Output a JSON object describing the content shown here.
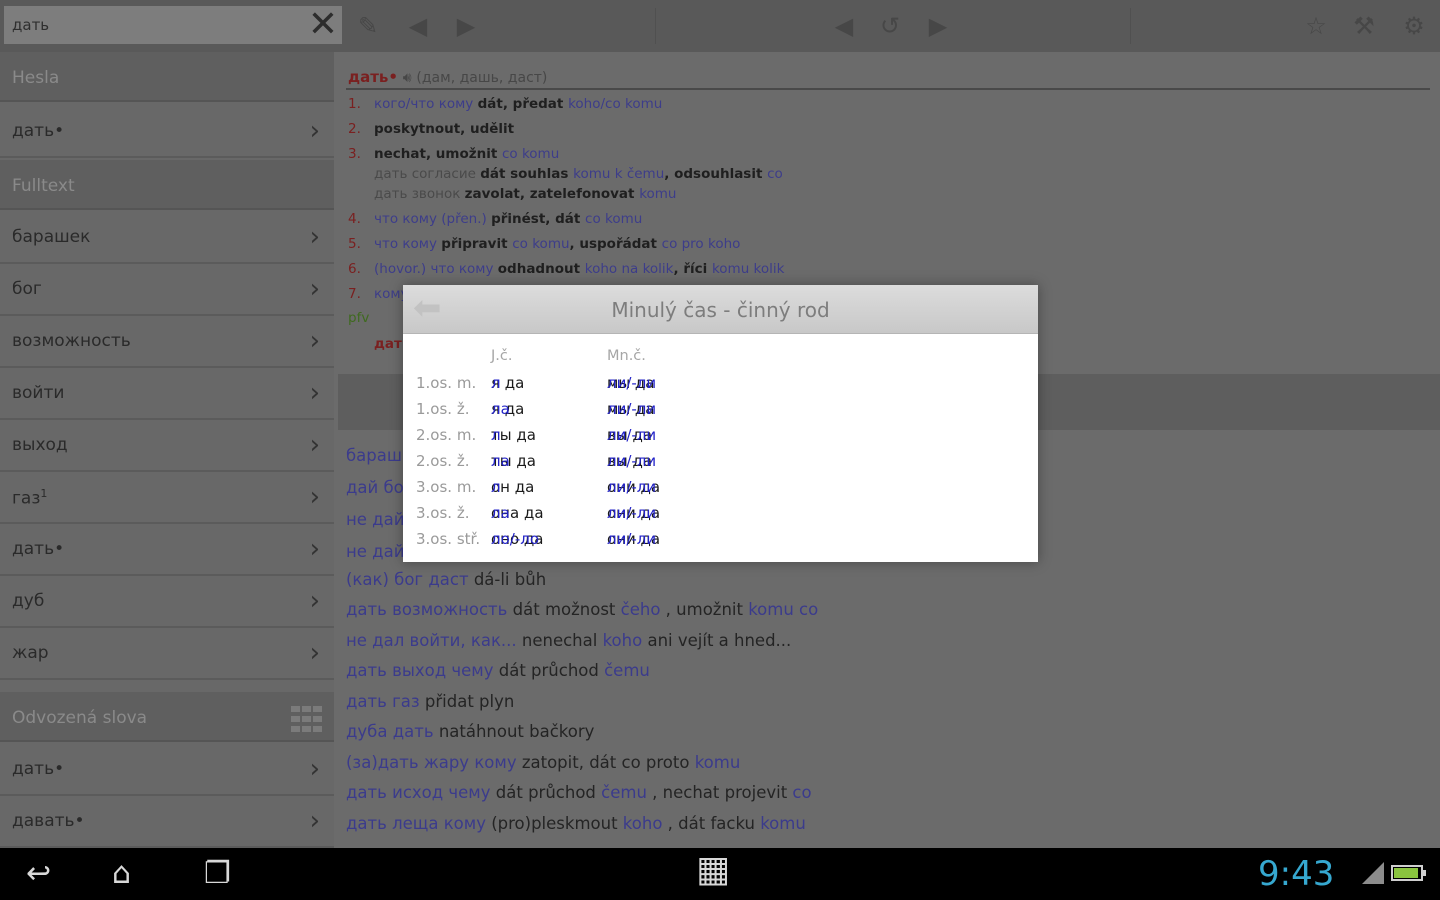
{
  "search": {
    "value": "дать"
  },
  "sidebar": {
    "sections": {
      "hesla": "Hesla",
      "fulltext": "Fulltext",
      "odvozena": "Odvozená slova"
    },
    "hesla_items": [
      {
        "label": "дать•"
      }
    ],
    "fulltext_items": [
      {
        "label": "барашек"
      },
      {
        "label": "бог"
      },
      {
        "label": "возможность"
      },
      {
        "label": "войти"
      },
      {
        "label": "выход"
      },
      {
        "label": "газ",
        "sup": "1"
      },
      {
        "label": "дать•"
      },
      {
        "label": "дуб"
      },
      {
        "label": "жар"
      }
    ],
    "odvozena_items": [
      {
        "label": "дать•"
      },
      {
        "label": "давать•"
      }
    ]
  },
  "entry": {
    "headword": "дать•",
    "forms": "(дам, дашь, даст)",
    "senses": [
      {
        "n": "1.",
        "parts": [
          [
            "ru",
            "кого/что кому "
          ],
          [
            "cz",
            "dát, předat "
          ],
          [
            "ru",
            "koho/co komu"
          ]
        ]
      },
      {
        "n": "2.",
        "parts": [
          [
            "cz",
            "poskytnout, udělit"
          ]
        ]
      },
      {
        "n": "3.",
        "parts": [
          [
            "cz",
            "nechat, umožnit "
          ],
          [
            "ru",
            "co komu"
          ]
        ]
      },
      {
        "n": "",
        "parts": [
          [
            "gr",
            "дать согласие "
          ],
          [
            "cz",
            "dát souhlas "
          ],
          [
            "ru",
            "komu k čemu"
          ],
          [
            "cz",
            ", odsouhlasit "
          ],
          [
            "ru",
            "co"
          ]
        ]
      },
      {
        "n": "",
        "parts": [
          [
            "gr",
            "дать звонок "
          ],
          [
            "cz",
            "zavolat, zatelefonovat "
          ],
          [
            "ru",
            "komu"
          ]
        ]
      },
      {
        "n": "4.",
        "parts": [
          [
            "ru",
            "что кому (přen.) "
          ],
          [
            "cz",
            "přinést, dát "
          ],
          [
            "ru",
            "co komu"
          ]
        ]
      },
      {
        "n": "5.",
        "parts": [
          [
            "ru",
            "что кому "
          ],
          [
            "cz",
            "připravit "
          ],
          [
            "ru",
            "co komu"
          ],
          [
            "cz",
            ", uspořádat "
          ],
          [
            "ru",
            "co pro koho"
          ]
        ]
      },
      {
        "n": "6.",
        "parts": [
          [
            "ru",
            "(hovor.) что кому "
          ],
          [
            "cz",
            "odhadnout "
          ],
          [
            "ru",
            "koho na kolik"
          ],
          [
            "cz",
            ", říci "
          ],
          [
            "ru",
            "komu kolik"
          ]
        ]
      },
      {
        "n": "7.",
        "parts": [
          [
            "ru",
            "кому"
          ]
        ]
      }
    ],
    "pfv_label": "pfv",
    "pfv_word": "дать"
  },
  "phrases": [
    {
      "ru": "бараш",
      "cz": ""
    },
    {
      "ru": "дай бо",
      "cz": ""
    },
    {
      "ru": "не дай",
      "cz": ""
    },
    {
      "ru": "не дай",
      "cz": ""
    },
    {
      "ru": "(как) бог даст",
      "cz": "dá-li bůh"
    },
    {
      "ru": "дать возможность",
      "cz": "dát možnost",
      "ru2": "čeho",
      "cz2": ", umožnit",
      "ru3": "komu co"
    },
    {
      "ru": "не дал войти, как...",
      "cz": "nenechal",
      "ru2": "koho",
      "cz2": "ani vejít a hned..."
    },
    {
      "ru": "дать выход чему",
      "cz": "dát průchod",
      "ru2": "čemu"
    },
    {
      "ru": "дать газ",
      "cz": "přidat plyn"
    },
    {
      "ru": "дуба дать",
      "cz": "natáhnout bačkory"
    },
    {
      "ru": "(за)дать жару кому",
      "cz": "zatopit, dát co proto",
      "ru2": "komu"
    },
    {
      "ru": "дать исход чему",
      "cz": "dát průchod",
      "ru2": "čemu",
      "cz2": ", nechat projevit",
      "ru3": "co"
    },
    {
      "ru": "дать леща кому",
      "cz": "(pro)pleskmout",
      "ru2": "koho",
      "cz2": ", dát facku",
      "ru3": "komu"
    }
  ],
  "dialog": {
    "title": "Minulý čas - činný rod",
    "col_singular": "J.č.",
    "col_plural": "Mn.č.",
    "rows": [
      {
        "label": "1.os. m.",
        "s_stem": "я да",
        "s_suf": "л",
        "p_stem": "мы да",
        "p_suf": "ли/-ли"
      },
      {
        "label": "1.os. ž.",
        "s_stem": "я да",
        "s_suf": "ла",
        "p_stem": "мы да",
        "p_suf": "ли/-ли"
      },
      {
        "label": "2.os. m.",
        "s_stem": "ты да",
        "s_suf": "л",
        "p_stem": "вы да",
        "p_suf": "ли/-ли"
      },
      {
        "label": "2.os. ž.",
        "s_stem": "ты да",
        "s_suf": "ла",
        "p_stem": "вы да",
        "p_suf": "ли/-ли"
      },
      {
        "label": "3.os. m.",
        "s_stem": "он да",
        "s_suf": "л",
        "p_stem": "они да",
        "p_suf": "ли/-ли"
      },
      {
        "label": "3.os. ž.",
        "s_stem": "она да",
        "s_suf": "ла",
        "p_stem": "они да",
        "p_suf": "ли/-ли"
      },
      {
        "label": "3.os. stř.",
        "s_stem": "оно да",
        "s_suf": "ло/-ло",
        "p_stem": "они да",
        "p_suf": "ли/-ли"
      }
    ]
  },
  "status": {
    "time": "9:43"
  },
  "icons": {
    "toolbar": [
      "edit-icon",
      "back-icon",
      "forward-icon",
      "history-back-icon",
      "history-icon",
      "history-forward-icon",
      "favorite-icon",
      "tools-icon",
      "settings-icon"
    ],
    "nav": [
      "back-icon",
      "home-icon",
      "recent-apps-icon",
      "app-grid-icon"
    ]
  },
  "colors": {
    "clock": "#36a8d0",
    "suffix": "#2323c8",
    "headword": "#7a2020",
    "russian": "#3d3d8a"
  }
}
